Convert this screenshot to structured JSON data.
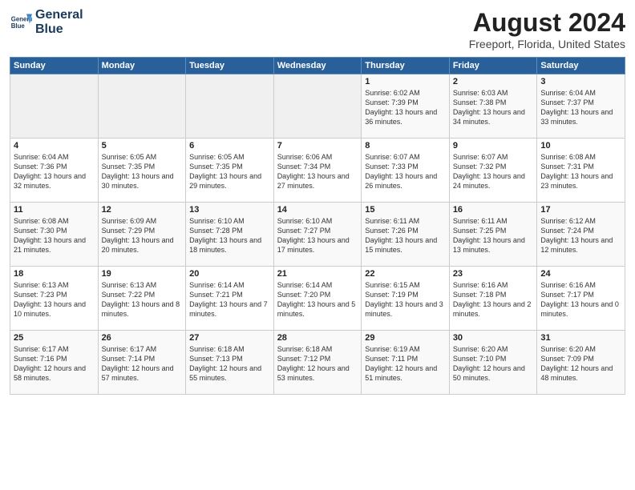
{
  "header": {
    "logo_line1": "General",
    "logo_line2": "Blue",
    "month_title": "August 2024",
    "location": "Freeport, Florida, United States"
  },
  "days_of_week": [
    "Sunday",
    "Monday",
    "Tuesday",
    "Wednesday",
    "Thursday",
    "Friday",
    "Saturday"
  ],
  "weeks": [
    {
      "days": [
        {
          "num": "",
          "empty": true
        },
        {
          "num": "",
          "empty": true
        },
        {
          "num": "",
          "empty": true
        },
        {
          "num": "",
          "empty": true
        },
        {
          "num": "1",
          "sunrise": "6:02 AM",
          "sunset": "7:39 PM",
          "daylight": "13 hours and 36 minutes."
        },
        {
          "num": "2",
          "sunrise": "6:03 AM",
          "sunset": "7:38 PM",
          "daylight": "13 hours and 34 minutes."
        },
        {
          "num": "3",
          "sunrise": "6:04 AM",
          "sunset": "7:37 PM",
          "daylight": "13 hours and 33 minutes."
        }
      ]
    },
    {
      "days": [
        {
          "num": "4",
          "sunrise": "6:04 AM",
          "sunset": "7:36 PM",
          "daylight": "13 hours and 32 minutes."
        },
        {
          "num": "5",
          "sunrise": "6:05 AM",
          "sunset": "7:35 PM",
          "daylight": "13 hours and 30 minutes."
        },
        {
          "num": "6",
          "sunrise": "6:05 AM",
          "sunset": "7:35 PM",
          "daylight": "13 hours and 29 minutes."
        },
        {
          "num": "7",
          "sunrise": "6:06 AM",
          "sunset": "7:34 PM",
          "daylight": "13 hours and 27 minutes."
        },
        {
          "num": "8",
          "sunrise": "6:07 AM",
          "sunset": "7:33 PM",
          "daylight": "13 hours and 26 minutes."
        },
        {
          "num": "9",
          "sunrise": "6:07 AM",
          "sunset": "7:32 PM",
          "daylight": "13 hours and 24 minutes."
        },
        {
          "num": "10",
          "sunrise": "6:08 AM",
          "sunset": "7:31 PM",
          "daylight": "13 hours and 23 minutes."
        }
      ]
    },
    {
      "days": [
        {
          "num": "11",
          "sunrise": "6:08 AM",
          "sunset": "7:30 PM",
          "daylight": "13 hours and 21 minutes."
        },
        {
          "num": "12",
          "sunrise": "6:09 AM",
          "sunset": "7:29 PM",
          "daylight": "13 hours and 20 minutes."
        },
        {
          "num": "13",
          "sunrise": "6:10 AM",
          "sunset": "7:28 PM",
          "daylight": "13 hours and 18 minutes."
        },
        {
          "num": "14",
          "sunrise": "6:10 AM",
          "sunset": "7:27 PM",
          "daylight": "13 hours and 17 minutes."
        },
        {
          "num": "15",
          "sunrise": "6:11 AM",
          "sunset": "7:26 PM",
          "daylight": "13 hours and 15 minutes."
        },
        {
          "num": "16",
          "sunrise": "6:11 AM",
          "sunset": "7:25 PM",
          "daylight": "13 hours and 13 minutes."
        },
        {
          "num": "17",
          "sunrise": "6:12 AM",
          "sunset": "7:24 PM",
          "daylight": "13 hours and 12 minutes."
        }
      ]
    },
    {
      "days": [
        {
          "num": "18",
          "sunrise": "6:13 AM",
          "sunset": "7:23 PM",
          "daylight": "13 hours and 10 minutes."
        },
        {
          "num": "19",
          "sunrise": "6:13 AM",
          "sunset": "7:22 PM",
          "daylight": "13 hours and 8 minutes."
        },
        {
          "num": "20",
          "sunrise": "6:14 AM",
          "sunset": "7:21 PM",
          "daylight": "13 hours and 7 minutes."
        },
        {
          "num": "21",
          "sunrise": "6:14 AM",
          "sunset": "7:20 PM",
          "daylight": "13 hours and 5 minutes."
        },
        {
          "num": "22",
          "sunrise": "6:15 AM",
          "sunset": "7:19 PM",
          "daylight": "13 hours and 3 minutes."
        },
        {
          "num": "23",
          "sunrise": "6:16 AM",
          "sunset": "7:18 PM",
          "daylight": "13 hours and 2 minutes."
        },
        {
          "num": "24",
          "sunrise": "6:16 AM",
          "sunset": "7:17 PM",
          "daylight": "13 hours and 0 minutes."
        }
      ]
    },
    {
      "days": [
        {
          "num": "25",
          "sunrise": "6:17 AM",
          "sunset": "7:16 PM",
          "daylight": "12 hours and 58 minutes."
        },
        {
          "num": "26",
          "sunrise": "6:17 AM",
          "sunset": "7:14 PM",
          "daylight": "12 hours and 57 minutes."
        },
        {
          "num": "27",
          "sunrise": "6:18 AM",
          "sunset": "7:13 PM",
          "daylight": "12 hours and 55 minutes."
        },
        {
          "num": "28",
          "sunrise": "6:18 AM",
          "sunset": "7:12 PM",
          "daylight": "12 hours and 53 minutes."
        },
        {
          "num": "29",
          "sunrise": "6:19 AM",
          "sunset": "7:11 PM",
          "daylight": "12 hours and 51 minutes."
        },
        {
          "num": "30",
          "sunrise": "6:20 AM",
          "sunset": "7:10 PM",
          "daylight": "12 hours and 50 minutes."
        },
        {
          "num": "31",
          "sunrise": "6:20 AM",
          "sunset": "7:09 PM",
          "daylight": "12 hours and 48 minutes."
        }
      ]
    }
  ],
  "labels": {
    "sunrise_prefix": "Sunrise: ",
    "sunset_prefix": "Sunset: ",
    "daylight_prefix": "Daylight: "
  }
}
